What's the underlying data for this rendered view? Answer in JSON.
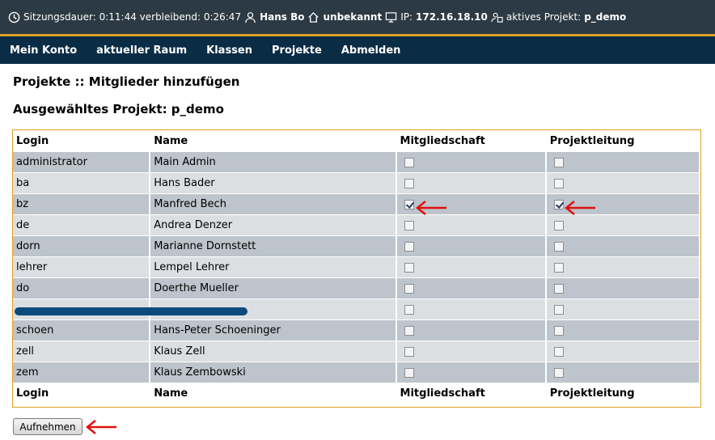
{
  "status": {
    "session_label": "Sitzungsdauer: 0:11:44 verbleibend: 0:26:47",
    "user": "Hans Bo",
    "room": "unbekannt",
    "ip_label": "IP:",
    "ip": "172.16.18.10",
    "project_label": "aktives Projekt:",
    "project": "p_demo"
  },
  "nav": {
    "items": [
      "Mein Konto",
      "aktueller Raum",
      "Klassen",
      "Projekte",
      "Abmelden"
    ]
  },
  "page": {
    "title": "Projekte :: Mitglieder hinzufügen",
    "selected_project": "Ausgewähltes Projekt: p_demo"
  },
  "table": {
    "headers": [
      "Login",
      "Name",
      "Mitgliedschaft",
      "Projektleitung"
    ],
    "rows": [
      {
        "login": "administrator",
        "name": "Main Admin",
        "member": false,
        "leader": false
      },
      {
        "login": "ba",
        "name": "Hans Bader",
        "member": false,
        "leader": false
      },
      {
        "login": "bz",
        "name": "Manfred Bech",
        "member": true,
        "leader": true
      },
      {
        "login": "de",
        "name": "Andrea Denzer",
        "member": false,
        "leader": false
      },
      {
        "login": "dorn",
        "name": "Marianne Dornstett",
        "member": false,
        "leader": false
      },
      {
        "login": "lehrer",
        "name": "Lempel Lehrer",
        "member": false,
        "leader": false
      },
      {
        "login": "do",
        "name": "Doerthe Mueller",
        "member": false,
        "leader": false
      },
      {
        "login": "",
        "name": "",
        "member": false,
        "leader": false
      },
      {
        "login": "schoen",
        "name": "Hans-Peter Schoeninger",
        "member": false,
        "leader": false
      },
      {
        "login": "zell",
        "name": "Klaus Zell",
        "member": false,
        "leader": false
      },
      {
        "login": "zem",
        "name": "Klaus Zembowski",
        "member": false,
        "leader": false
      }
    ]
  },
  "submit_label": "Aufnehmen",
  "colors": {
    "statusbar": "#2b3a44",
    "navbar": "#0b2c45",
    "accent": "#e0a026",
    "row_dark": "#bdc4cb",
    "row_light": "#dcdfe2",
    "arrow": "#e01010"
  }
}
